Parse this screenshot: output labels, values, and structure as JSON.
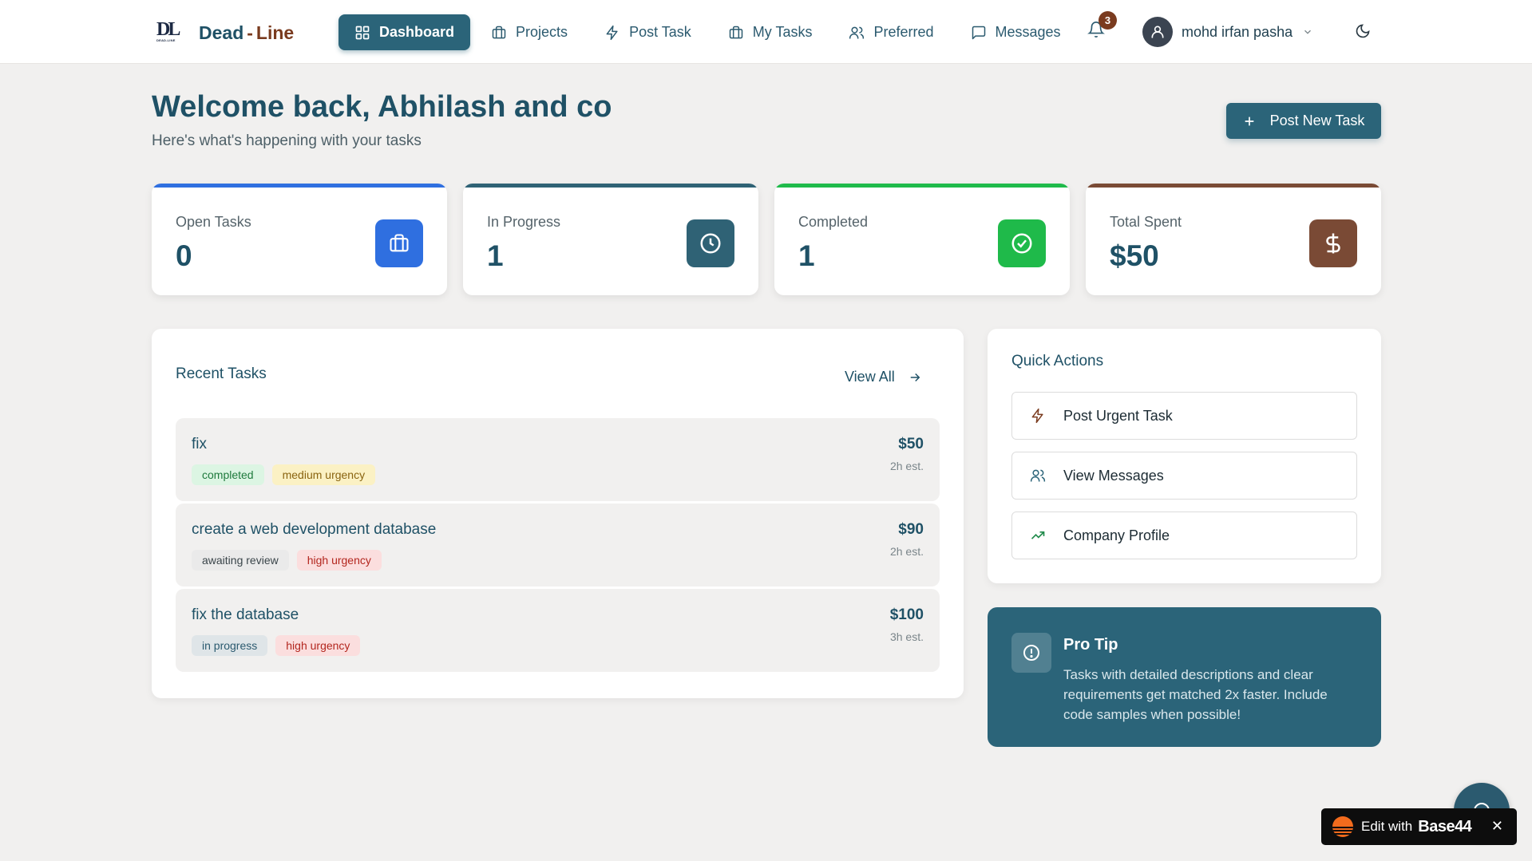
{
  "brand": {
    "mark": "DL",
    "mark_small": "DEAD-LINE",
    "name_part1": "Dead",
    "name_sep": "-",
    "name_part2": "Line"
  },
  "nav": {
    "items": [
      {
        "label": "Dashboard",
        "icon": "grid-icon",
        "active": true
      },
      {
        "label": "Projects",
        "icon": "briefcase-icon"
      },
      {
        "label": "Post Task",
        "icon": "lightning-icon"
      },
      {
        "label": "My Tasks",
        "icon": "briefcase-icon"
      },
      {
        "label": "Preferred",
        "icon": "users-icon"
      },
      {
        "label": "Messages",
        "icon": "message-icon"
      }
    ]
  },
  "notifications": {
    "count": "3"
  },
  "user": {
    "name": "mohd irfan pasha"
  },
  "welcome": {
    "title": "Welcome back, Abhilash and co",
    "subtitle": "Here's what's happening with your tasks",
    "post_button": "Post New Task"
  },
  "stats": [
    {
      "label": "Open Tasks",
      "value": "0",
      "color": "#2f6fe0"
    },
    {
      "label": "In Progress",
      "value": "1",
      "color": "#2f6275"
    },
    {
      "label": "Completed",
      "value": "1",
      "color": "#1fba4a"
    },
    {
      "label": "Total Spent",
      "value": "$50",
      "color": "#7a4a35"
    }
  ],
  "recent": {
    "title": "Recent Tasks",
    "view_all": "View All",
    "tasks": [
      {
        "title": "fix",
        "status": "completed",
        "urgency": "medium urgency",
        "price": "$50",
        "est": "2h est."
      },
      {
        "title": "create a web development database",
        "status": "awaiting review",
        "urgency": "high urgency",
        "price": "$90",
        "est": "2h est."
      },
      {
        "title": "fix the database",
        "status": "in progress",
        "urgency": "high urgency",
        "price": "$100",
        "est": "3h est."
      }
    ]
  },
  "quick_actions": {
    "title": "Quick Actions",
    "items": [
      {
        "label": "Post Urgent Task",
        "icon": "lightning-icon"
      },
      {
        "label": "View Messages",
        "icon": "users-icon"
      },
      {
        "label": "Company Profile",
        "icon": "trending-up-icon"
      }
    ]
  },
  "pro_tip": {
    "title": "Pro Tip",
    "body": "Tasks with detailed descriptions and clear requirements get matched 2x faster. Include code samples when possible!"
  },
  "base44_badge": {
    "edit": "Edit with",
    "brand": "Base44",
    "close": "✕"
  }
}
